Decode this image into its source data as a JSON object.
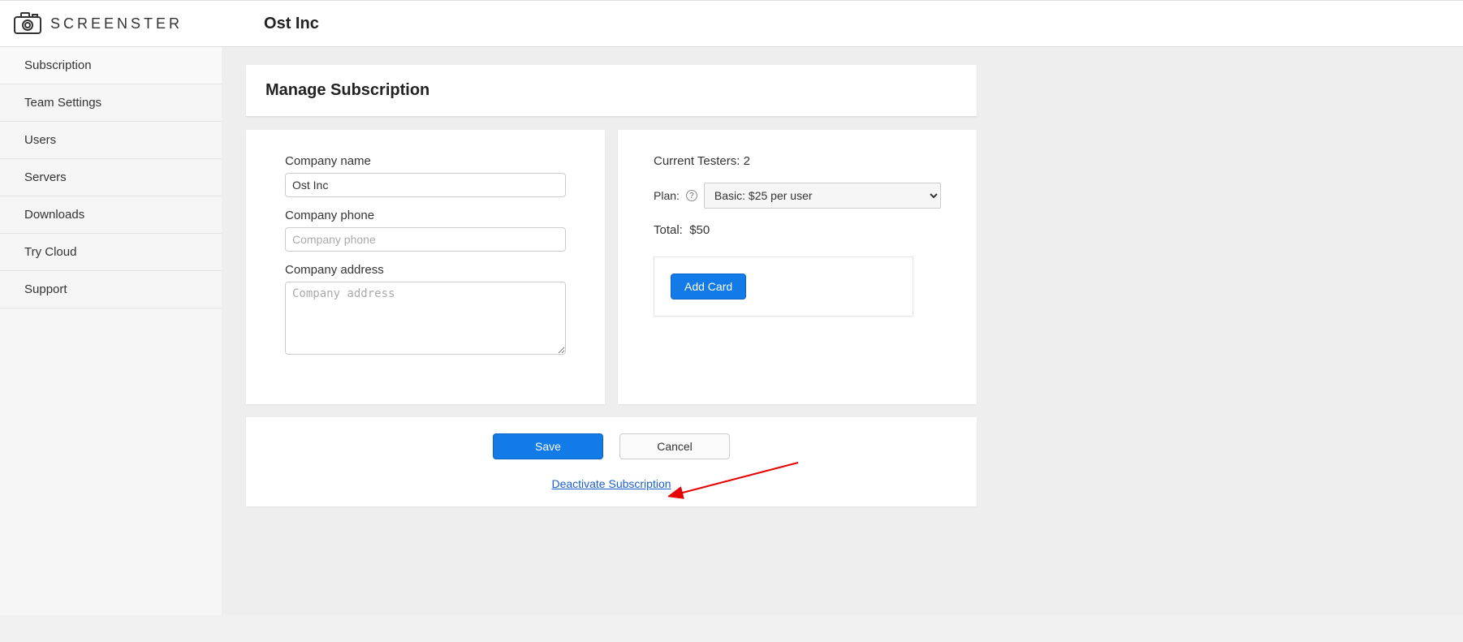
{
  "header": {
    "brand": "SCREENSTER",
    "org": "Ost Inc"
  },
  "sidebar": {
    "items": [
      {
        "label": "Subscription"
      },
      {
        "label": "Team Settings"
      },
      {
        "label": "Users"
      },
      {
        "label": "Servers"
      },
      {
        "label": "Downloads"
      },
      {
        "label": "Try Cloud"
      },
      {
        "label": "Support"
      }
    ]
  },
  "page": {
    "title": "Manage Subscription"
  },
  "company_form": {
    "name_label": "Company name",
    "name_value": "Ost Inc",
    "phone_label": "Company phone",
    "phone_placeholder": "Company phone",
    "address_label": "Company address",
    "address_placeholder": "Company address"
  },
  "plan_panel": {
    "testers_label": "Current Testers: 2",
    "plan_label": "Plan:",
    "plan_selected": "Basic: $25 per user",
    "total_label": "Total:",
    "total_value": "$50",
    "add_card_label": "Add Card"
  },
  "actions": {
    "save_label": "Save",
    "cancel_label": "Cancel",
    "deactivate_label": "Deactivate Subscription"
  }
}
